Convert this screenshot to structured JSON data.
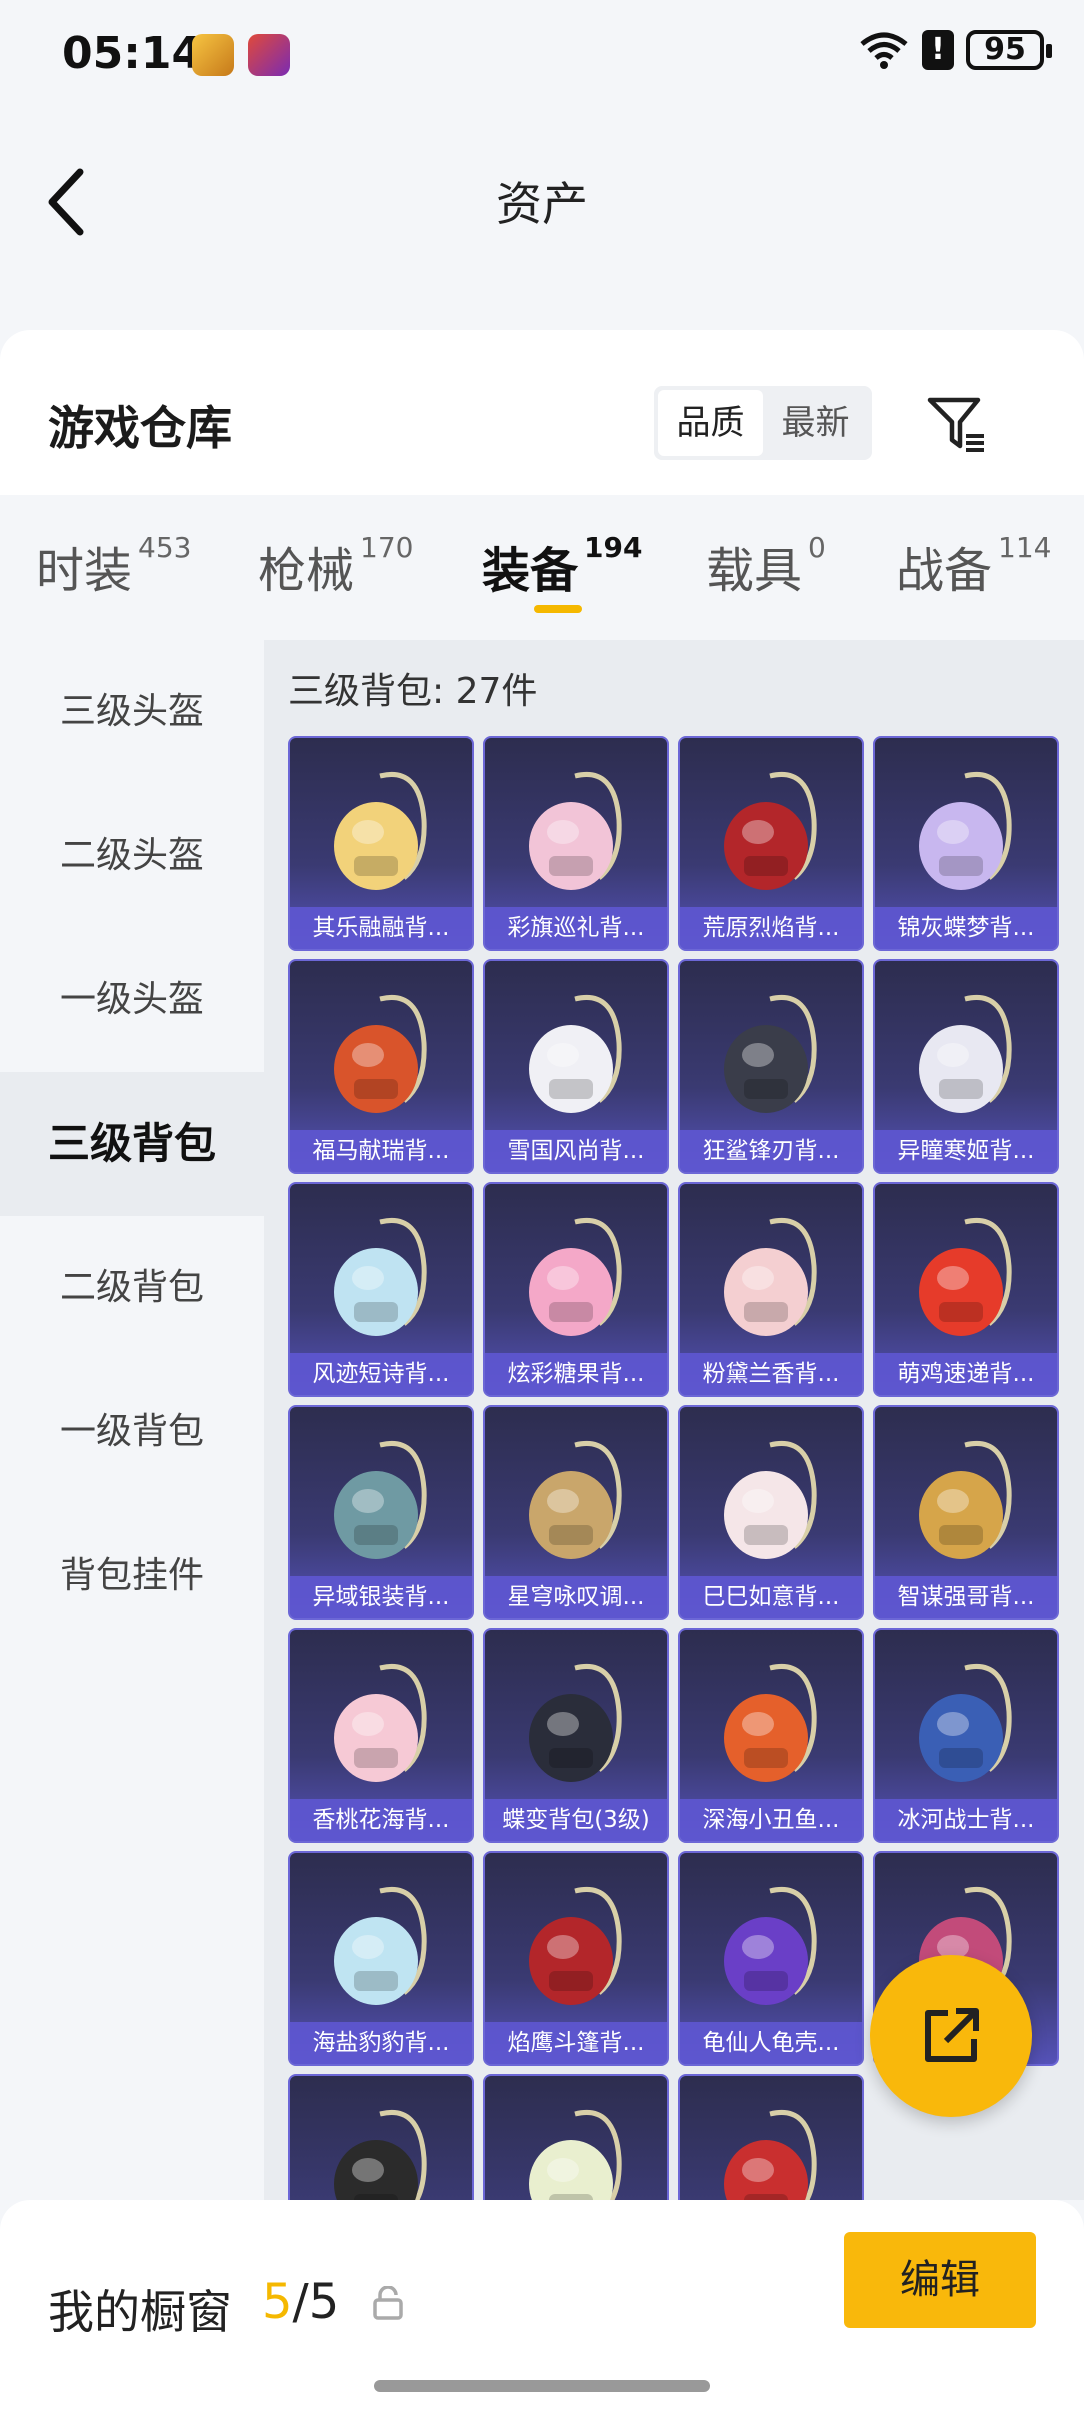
{
  "status": {
    "time": "05:14",
    "battery": "95",
    "alert": "!"
  },
  "header": {
    "title": "资产"
  },
  "warehouse": {
    "title": "游戏仓库",
    "sort_options": [
      "品质",
      "最新"
    ],
    "active_sort": "品质"
  },
  "categories": [
    {
      "label": "时装",
      "count": "453"
    },
    {
      "label": "枪械",
      "count": "170"
    },
    {
      "label": "装备",
      "count": "194"
    },
    {
      "label": "载具",
      "count": "0"
    },
    {
      "label": "战备",
      "count": "114"
    }
  ],
  "active_category": "装备",
  "sidebar": {
    "items": [
      "三级头盔",
      "二级头盔",
      "一级头盔",
      "三级背包",
      "二级背包",
      "一级背包",
      "背包挂件"
    ],
    "active": "三级背包"
  },
  "content": {
    "title": "三级背包: 27件",
    "items": [
      {
        "name": "其乐融融背...",
        "color": "#f2d27a"
      },
      {
        "name": "彩旗巡礼背...",
        "color": "#f2c4d7"
      },
      {
        "name": "荒原烈焰背...",
        "color": "#b3262a"
      },
      {
        "name": "锦灰蝶梦背...",
        "color": "#c8b7ef"
      },
      {
        "name": "福马献瑞背...",
        "color": "#d9542b"
      },
      {
        "name": "雪国风尚背...",
        "color": "#f0f0f5"
      },
      {
        "name": "狂鲨锋刃背...",
        "color": "#3a3d4a"
      },
      {
        "name": "异瞳寒姬背...",
        "color": "#e8e8f2"
      },
      {
        "name": "风迹短诗背...",
        "color": "#bfe3f2"
      },
      {
        "name": "炫彩糖果背...",
        "color": "#f4a8c8"
      },
      {
        "name": "粉黛兰香背...",
        "color": "#f4cfd1"
      },
      {
        "name": "萌鸡速递背...",
        "color": "#e63b2a"
      },
      {
        "name": "异域银装背...",
        "color": "#6f9aa3"
      },
      {
        "name": "星穹咏叹调...",
        "color": "#c9a66b"
      },
      {
        "name": "巳巳如意背...",
        "color": "#f5e6e8"
      },
      {
        "name": "智谋强哥背...",
        "color": "#d6a54a"
      },
      {
        "name": "香桃花海背...",
        "color": "#f6c9d5"
      },
      {
        "name": "蝶变背包(3级)",
        "color": "#2a2d3a"
      },
      {
        "name": "深海小丑鱼...",
        "color": "#e5602b"
      },
      {
        "name": "冰河战士背...",
        "color": "#3a5fb5"
      },
      {
        "name": "海盐豹豹背...",
        "color": "#bfe4f2"
      },
      {
        "name": "焰鹰斗篷背...",
        "color": "#b3262a"
      },
      {
        "name": "龟仙人龟壳...",
        "color": "#6a3fc7"
      },
      {
        "name": "",
        "color": "#c24b7a"
      },
      {
        "name": "",
        "color": "#2b2b2b"
      },
      {
        "name": "",
        "color": "#e9efcf"
      },
      {
        "name": "",
        "color": "#c92f2f"
      }
    ]
  },
  "showcase": {
    "label": "我的橱窗",
    "current": "5",
    "total": "/5"
  },
  "edit_label": "编辑"
}
